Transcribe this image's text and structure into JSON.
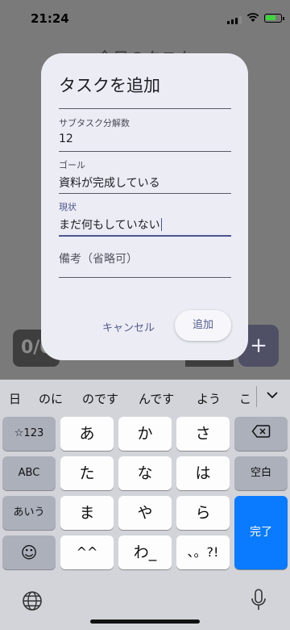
{
  "status_bar": {
    "time": "21:24"
  },
  "background": {
    "title": "今日のタスク",
    "counter": "0/0",
    "plus": "+"
  },
  "dialog": {
    "title": "タスクを追加",
    "fields": [
      {
        "label": "サブタスク分解数",
        "value": "12"
      },
      {
        "label": "ゴール",
        "value": "資料が完成している"
      },
      {
        "label": "現状",
        "value": "まだ何もしていない"
      },
      {
        "label": "",
        "placeholder": "備考（省略可）"
      }
    ],
    "cancel_label": "キャンセル",
    "add_label": "追加"
  },
  "keyboard": {
    "suggestions": [
      "日",
      "のに",
      "のです",
      "んです",
      "よう",
      "こ"
    ],
    "rows": [
      [
        "☆123",
        "あ",
        "か",
        "さ",
        "⌫"
      ],
      [
        "ABC",
        "た",
        "な",
        "は",
        "空白"
      ],
      [
        "あいう",
        "ま",
        "や",
        "ら",
        "完了"
      ],
      [
        "☺",
        "^^",
        "わ_",
        "、。?!"
      ]
    ]
  },
  "colors": {
    "accent": "#4b5590",
    "done_key": "#0a7aff",
    "dialog_bg": "#ececf4"
  }
}
